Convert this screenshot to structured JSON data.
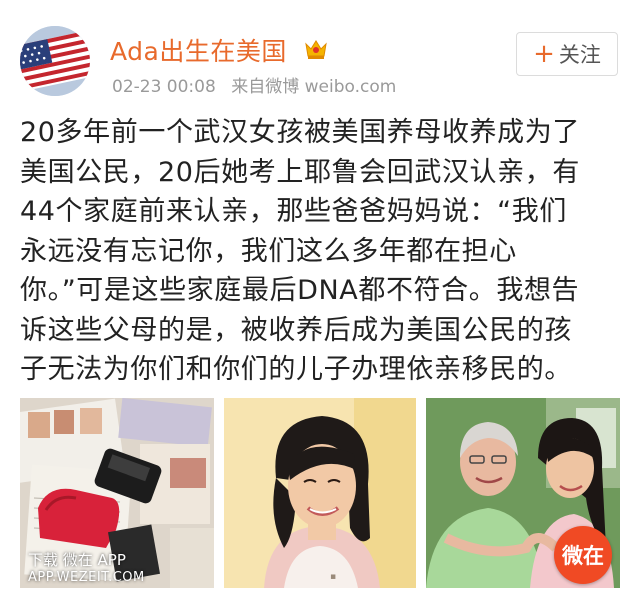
{
  "user": {
    "name": "Ada出生在美国",
    "timestamp": "02-23 00:08",
    "source": "来自微博 weibo.com",
    "avatar_icon": "us-flag-avatar",
    "badge_icon": "vip-crown-icon"
  },
  "follow_button": {
    "plus": "+",
    "label": "关注"
  },
  "post": {
    "lines": [
      "20多年前一个武汉女孩被美国养母收养成为了",
      "美国公民，20后她考上耶鲁会回武汉认亲，有",
      "44个家庭前来认亲，那些爸爸妈妈说：“我们",
      "永远没有忘记你，我们这么多年都在担心",
      "你。”可是这些家庭最后DNA都不符合。我想告",
      "诉这些父母的是，被收养后成为美国公民的孩",
      "子无法为你们和你们的儿子办理依亲移民的。"
    ]
  },
  "images": [
    {
      "icon": "photo-thumbnail-documents"
    },
    {
      "icon": "photo-thumbnail-portrait"
    },
    {
      "icon": "photo-thumbnail-mother-daughter"
    }
  ],
  "watermark": {
    "line1": "下载 微在 APP",
    "line2": "APP.WEZEIT.COM",
    "badge": "微在"
  },
  "colors": {
    "username": "#e86a2c",
    "badge": "#f04a24",
    "meta": "#9a9a9a"
  }
}
